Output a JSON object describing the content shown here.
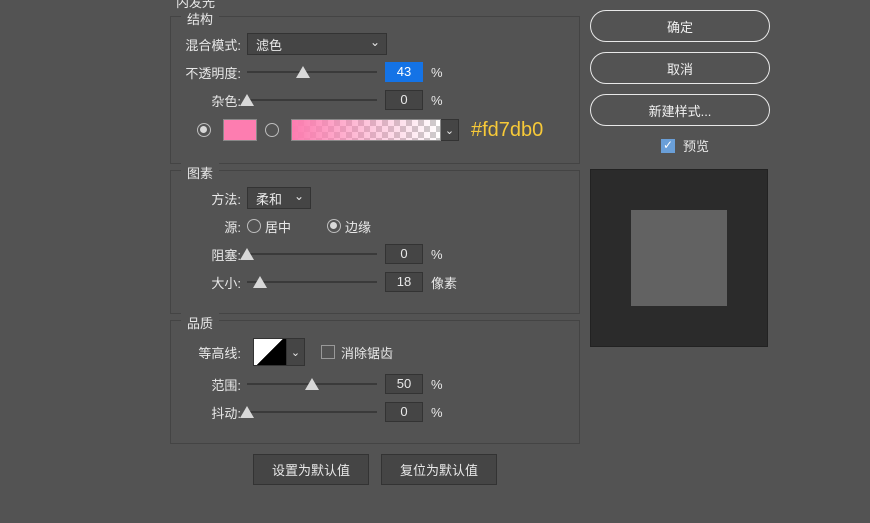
{
  "outer_title": "内发光",
  "structure": {
    "title": "结构",
    "blend_mode_label": "混合模式:",
    "blend_mode_value": "滤色",
    "opacity_label": "不透明度:",
    "opacity_value": "43",
    "opacity_unit": "%",
    "noise_label": "杂色:",
    "noise_value": "0",
    "noise_unit": "%",
    "hex": "#fd7db0"
  },
  "elements": {
    "title": "图素",
    "method_label": "方法:",
    "method_value": "柔和",
    "source_label": "源:",
    "source_center": "居中",
    "source_edge": "边缘",
    "choke_label": "阻塞:",
    "choke_value": "0",
    "choke_unit": "%",
    "size_label": "大小:",
    "size_value": "18",
    "size_unit": "像素"
  },
  "quality": {
    "title": "品质",
    "contour_label": "等高线:",
    "antialias_label": "消除锯齿",
    "range_label": "范围:",
    "range_value": "50",
    "range_unit": "%",
    "jitter_label": "抖动:",
    "jitter_value": "0",
    "jitter_unit": "%"
  },
  "buttons": {
    "set_default": "设置为默认值",
    "reset_default": "复位为默认值"
  },
  "side": {
    "ok": "确定",
    "cancel": "取消",
    "new_style": "新建样式...",
    "preview": "预览"
  }
}
